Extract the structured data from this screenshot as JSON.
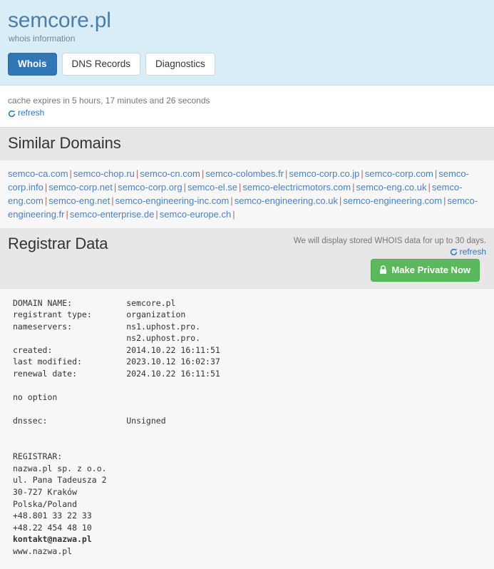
{
  "header": {
    "domain_title": "semcore.pl",
    "subtitle": "whois information",
    "tabs": [
      {
        "label": "Whois",
        "active": true
      },
      {
        "label": "DNS Records",
        "active": false
      },
      {
        "label": "Diagnostics",
        "active": false
      }
    ]
  },
  "cache": {
    "text": "cache expires in 5 hours, 17 minutes and 26 seconds",
    "refresh_label": "refresh",
    "refresh_icon": "refresh-icon"
  },
  "similar_domains": {
    "heading": "Similar Domains",
    "separator": "|",
    "items": [
      "semco-ca.com",
      "semco-chop.ru",
      "semco-cn.com",
      "semco-colombes.fr",
      "semco-corp.co.jp",
      "semco-corp.com",
      "semco-corp.info",
      "semco-corp.net",
      "semco-corp.org",
      "semco-el.se",
      "semco-electricmotors.com",
      "semco-eng.co.uk",
      "semco-eng.com",
      "semco-eng.net",
      "semco-engineering-inc.com",
      "semco-engineering.co.uk",
      "semco-engineering.com",
      "semco-engineering.fr",
      "semco-enterprise.de",
      "semco-europe.ch"
    ]
  },
  "registrar_section": {
    "heading": "Registrar Data",
    "note": "We will display stored WHOIS data for up to 30 days.",
    "refresh_label": "refresh",
    "refresh_icon": "refresh-icon",
    "make_private_label": "Make Private Now",
    "lock_icon": "lock-icon"
  },
  "whois": {
    "lines_before_email": "DOMAIN NAME:           semcore.pl\nregistrant type:       organization\nnameservers:           ns1.uphost.pro.\n                       ns2.uphost.pro.\ncreated:               2014.10.22 16:11:51\nlast modified:         2023.10.12 16:02:37\nrenewal date:          2024.10.22 16:11:51\n\nno option\n\ndnssec:                Unsigned\n\n\nREGISTRAR:\nnazwa.pl sp. z o.o.\nul. Pana Tadeusza 2\n30-727 Kraków\nPolska/Poland\n+48.801 33 22 33\n+48.22 454 48 10\n",
    "email": "kontakt@nazwa.pl",
    "lines_after_email": "\nwww.nazwa.pl"
  }
}
